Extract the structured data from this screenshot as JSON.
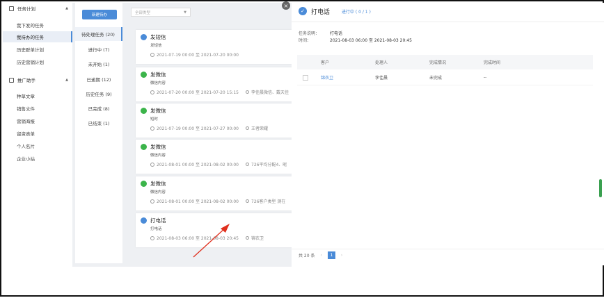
{
  "nav": {
    "group1": "任务计划",
    "group1_items": [
      "我下发的任务",
      "我待办的任务",
      "历史群单计划",
      "历史营销计划"
    ],
    "group2": "推广助手",
    "group2_items": [
      "种草文章",
      "销售文件",
      "营销海报",
      "留资表单",
      "个人名片",
      "企业小站"
    ]
  },
  "toolbar": {
    "new_button": "新建待办",
    "type_placeholder": "全部类型"
  },
  "status_filters": [
    "待处理任务 (20)",
    "进行中 (7)",
    "未开始 (1)",
    "已逾期 (12)",
    "历史任务 (9)",
    "已完成 (8)",
    "已结束 (1)"
  ],
  "tasks": [
    {
      "title": "发短信",
      "sub": "发短信",
      "time": "2021-07-19 00:00 至 2021-07-20 00:00",
      "who": "",
      "icon": "message-icon",
      "color": "#4a8bd8"
    },
    {
      "title": "发微信",
      "sub": "微信内容",
      "time": "2021-07-20 00:00 至 2021-07-20 15:15",
      "who": "李佳晨微信、戴天佳",
      "icon": "wechat-icon",
      "color": "#3bb44a"
    },
    {
      "title": "发微信",
      "sub": "短时",
      "time": "2021-07-19 00:00 至 2021-07-27 00:00",
      "who": "王者荣耀",
      "icon": "wechat-icon",
      "color": "#3bb44a"
    },
    {
      "title": "发微信",
      "sub": "微信内容",
      "time": "2021-08-01 00:00 至 2021-08-02 00:00",
      "who": "726平均分配4、昵",
      "icon": "wechat-icon",
      "color": "#3bb44a"
    },
    {
      "title": "发微信",
      "sub": "微信内容",
      "time": "2021-08-01 00:00 至 2021-08-02 00:00",
      "who": "726客户类型 测在",
      "icon": "wechat-icon",
      "color": "#3bb44a"
    },
    {
      "title": "打电话",
      "sub": "打电话",
      "time": "2021-08-03 06:00 至 2021-08-03 20:45",
      "who": "锦衣卫",
      "icon": "phone-icon",
      "color": "#4a8bd8"
    }
  ],
  "detail": {
    "title": "打电话",
    "status": "进行中 ( 0 / 1 )",
    "desc_label": "任务说明：",
    "desc_value": "打电话",
    "time_label": "时间：",
    "time_value": "2021-08-03 06:00 至 2021-08-03 20:45",
    "columns": [
      "客户",
      "处理人",
      "完成情况",
      "完成时间"
    ],
    "rows": [
      {
        "customer": "锦衣卫",
        "handler": "李佳晨",
        "status": "未完成",
        "done_time": "--"
      }
    ],
    "total": "共 20 条",
    "page": "1"
  }
}
